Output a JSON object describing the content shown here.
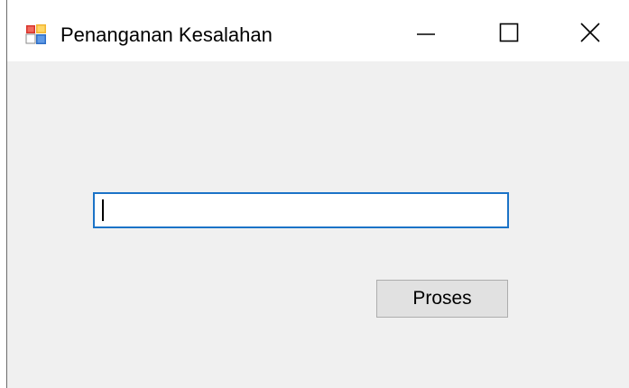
{
  "window": {
    "title": "Penanganan Kesalahan",
    "app_icon": "winforms-app-icon",
    "controls": {
      "minimize_icon": "minimize-icon",
      "maximize_icon": "maximize-icon",
      "close_icon": "close-icon"
    }
  },
  "form": {
    "input_value": "",
    "input_placeholder": "",
    "button_label": "Proses"
  },
  "colors": {
    "client_background": "#f0f0f0",
    "titlebar_background": "#ffffff",
    "input_focus_border": "#1b73c7",
    "button_background": "#e1e1e1",
    "button_border": "#adadad"
  }
}
